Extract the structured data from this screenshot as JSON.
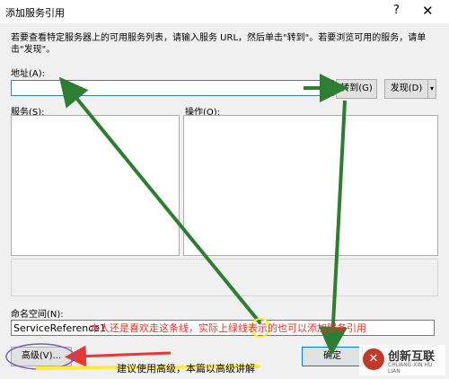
{
  "dialog": {
    "title": "添加服务引用",
    "help_glyph": "?",
    "close_glyph": "✕",
    "description": "若要查看特定服务器上的可用服务列表，请输入服务 URL，然后单击\"转到\"。若要浏览可用的服务，请单击\"发现\"。",
    "address_label": "地址(A):",
    "address_value": "",
    "go_button": "转到(G)",
    "discover_button": "发现(D)",
    "discover_arrow": "▾",
    "services_label": "服务(S):",
    "operations_label": "操作(O):",
    "namespace_label": "命名空间(N):",
    "namespace_value": "ServiceReference1",
    "advanced_button": "高级(V)...",
    "ok_button": "确定",
    "cancel_button": ""
  },
  "annotations": {
    "red_note": "本人还是喜欢走这条线，实际上绿线表示的也可以添加服务引用",
    "bottom_note": "建议使用高级，本篇以高级讲解"
  },
  "watermark": {
    "mark": "✕",
    "brand": "创新互联",
    "subtitle": "CHUANG XIN HU LIAN"
  },
  "colors": {
    "green_arrow": "#2e7d32",
    "red_text": "#e8312a",
    "highlight": "#ffeb3b",
    "focus_border": "#3c7fb1"
  }
}
